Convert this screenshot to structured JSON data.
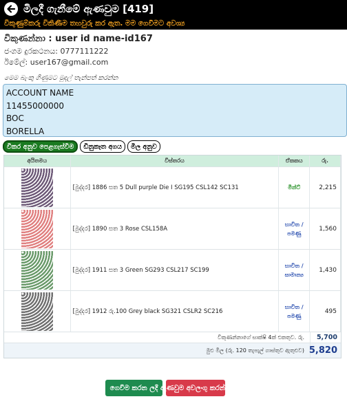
{
  "header": {
    "title": "මිලදී ගැනීමේ ඇණවුම [419]",
    "notice": "විකුණුම්කරු විකිණීම තහවුරු කර ඇත. මම ගෙවීමට අවශ්‍ය"
  },
  "seller": {
    "name_label": "විකුණන්නා :",
    "name_value": "user id name-id167",
    "phone_label": "ජංගම දුරකථනය:",
    "phone_value": "0777111222",
    "email_label": "ඊමේල්:",
    "email_value": "user167@gmail.com"
  },
  "bank": {
    "prompt": "මෙම බැංකු ගිණුමට මුදල් තැන්පත් කරන්න",
    "lines": [
      "ACCOUNT NAME",
      "11455000000",
      "BOC",
      "BORELLA"
    ]
  },
  "actions": {
    "tab1": "විකර අනුව පෙළගැස්වීම",
    "tab2": "ඩිනුකෑත අගය",
    "tab3": "මිල අනුව"
  },
  "table": {
    "headers": [
      "අයිතමය",
      "විස්තරය",
      "ඒකකය",
      "රු."
    ],
    "rows": [
      {
        "description": "[මුද්දර] 1886 සත 5 Dull purple Die I SG195 CSL142 SC131",
        "unit": "මින්ට්",
        "unit_color": "#1a8a1a",
        "price": "2,215",
        "stamp_color": "#6e5a78"
      },
      {
        "description": "[මුද්දර] 1890 සත 3 Rose CSL158A",
        "unit": "භාවිත / පමණු",
        "unit_color": "#2a4fb0",
        "price": "1,560",
        "stamp_color": "#e08080"
      },
      {
        "description": "[මුද්දර] 1911 සත 3 Green SG293 CSL217 SC199",
        "unit": "භාවිත / සාමාන්‍ය",
        "unit_color": "#2a4fb0",
        "price": "1,430",
        "stamp_color": "#6a9a6a"
      },
      {
        "description": "[මුද්දර] 1912 රු.100 Grey black SG321 CSLR2 SC216",
        "unit": "භාවිත / පමණු",
        "unit_color": "#2a4fb0",
        "price": "495",
        "stamp_color": "#707070"
      }
    ],
    "subtotal_label": "විකුණන්නාගේ සාක්ෂි 4ක් එකතුව. රු.",
    "subtotal_value": "5,700",
    "total_label": "මුළු මිල (රු. 120 තැපැල් ගාස්තුව ඇතුළුව)",
    "total_value": "5,820"
  },
  "buttons": {
    "send": "ගෙවීම කරන ලදී",
    "cancel": "ඇණවුම අවලංගු කරන්න"
  }
}
